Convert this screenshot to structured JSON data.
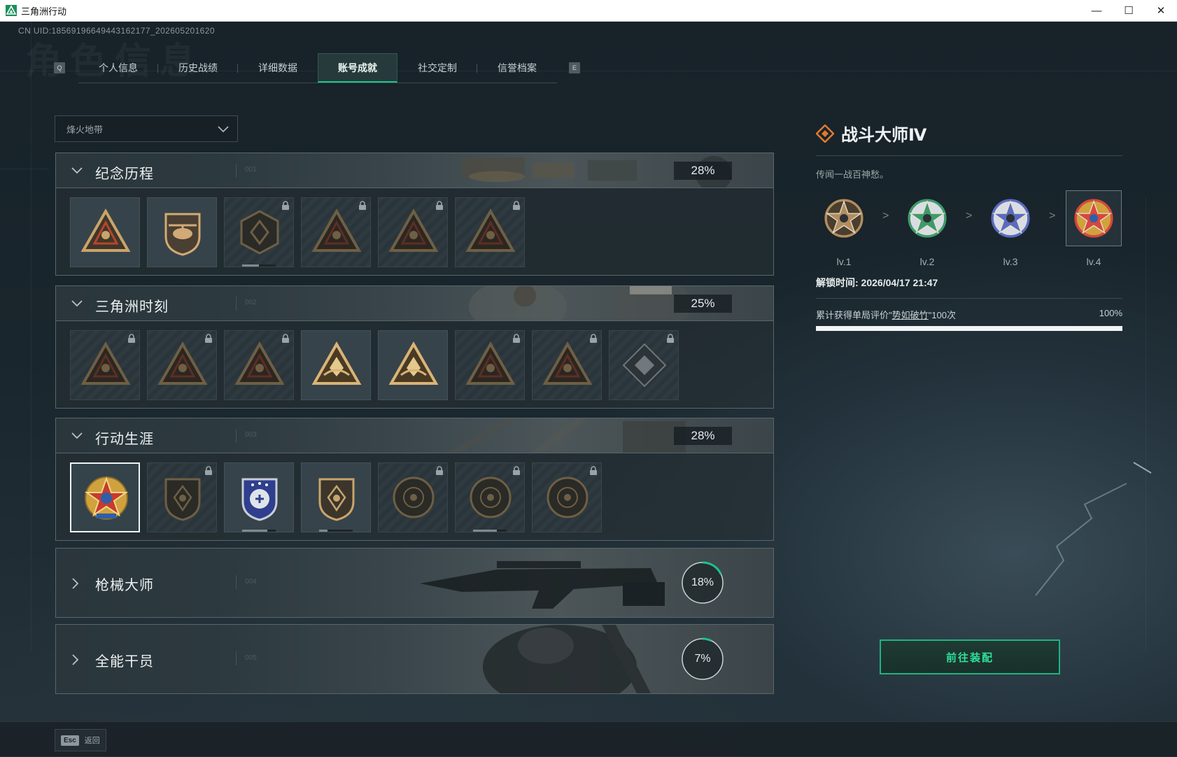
{
  "window": {
    "title": "三角洲行动",
    "controls": {
      "minimize": "—",
      "maximize": "☐",
      "close": "✕"
    }
  },
  "bg_word": "角色信息",
  "uid": "CN UID:18569196649443162177_202605201620",
  "tabs": {
    "key_left": "Q",
    "key_right": "E",
    "items": [
      {
        "label": "个人信息"
      },
      {
        "label": "历史战绩"
      },
      {
        "label": "详细数据"
      },
      {
        "label": "账号成就",
        "active": true
      },
      {
        "label": "社交定制"
      },
      {
        "label": "信誉档案"
      }
    ]
  },
  "filter": {
    "selected": "烽火地带"
  },
  "sections": [
    {
      "title": "纪念历程",
      "num": "001",
      "percent": "28%",
      "expanded": true
    },
    {
      "title": "三角洲时刻",
      "num": "002",
      "percent": "25%",
      "expanded": true
    },
    {
      "title": "行动生涯",
      "num": "003",
      "percent": "28%",
      "expanded": true
    },
    {
      "title": "枪械大师",
      "num": "004",
      "percent": "18%",
      "progress": 0.18,
      "expanded": false
    },
    {
      "title": "全能干员",
      "num": "005",
      "percent": "7%",
      "progress": 0.07,
      "expanded": false
    }
  ],
  "badges": {
    "s1": [
      {
        "icon": "triangle-shield-badge-icon",
        "locked": false
      },
      {
        "icon": "helicopter-badge-icon",
        "locked": false
      },
      {
        "icon": "hex-emblem-badge-icon",
        "locked": true,
        "progress": 0.5
      },
      {
        "icon": "warrior-triangle-badge-icon",
        "locked": true
      },
      {
        "icon": "hooded-figure-badge-icon",
        "locked": true
      },
      {
        "icon": "skull-triangle-badge-icon",
        "locked": true
      }
    ],
    "s2": [
      {
        "icon": "bottle-triangle-badge-icon",
        "locked": true
      },
      {
        "icon": "soldier-triangle-badge-icon",
        "locked": true
      },
      {
        "icon": "crouching-figure-badge-icon",
        "locked": true
      },
      {
        "icon": "hands-crystal-badge-icon",
        "locked": false
      },
      {
        "icon": "strongman-badge-icon",
        "locked": false
      },
      {
        "icon": "beast-triangle-badge-icon",
        "locked": true
      },
      {
        "icon": "fish-triangle-badge-icon",
        "locked": true
      },
      {
        "icon": "crystal-diamond-badge-icon",
        "locked": true
      }
    ],
    "s3": [
      {
        "icon": "combat-master-star-badge-icon",
        "locked": false,
        "selected": true
      },
      {
        "icon": "winged-shield-badge-icon",
        "locked": true
      },
      {
        "icon": "blue-star-shield-badge-icon",
        "locked": false,
        "progress": 0.75
      },
      {
        "icon": "gem-shield-badge-icon",
        "locked": false,
        "progress": 0.25
      },
      {
        "icon": "shell-circle-badge-icon",
        "locked": true
      },
      {
        "icon": "skull-circle-badge-icon",
        "locked": true,
        "progress": 0.7
      },
      {
        "icon": "eye-circle-badge-icon",
        "locked": true
      }
    ]
  },
  "detail": {
    "title": "战斗大师Ⅳ",
    "description": "传闻一战百神愁。",
    "levels": [
      {
        "label": "lv.1",
        "icon": "bronze-star-medal-icon",
        "color": "#b28d5e"
      },
      {
        "label": "lv.2",
        "icon": "green-star-medal-icon",
        "color": "#3f9a6a"
      },
      {
        "label": "lv.3",
        "icon": "blue-star-medal-icon",
        "color": "#5a6bc0"
      },
      {
        "label": "lv.4",
        "icon": "gold-star-medal-icon",
        "color": "#d6473d",
        "selected": true
      }
    ],
    "separator": ">",
    "unlock_time": "解锁时间: 2026/04/17 21:47",
    "condition": {
      "prefix": "累计获得单局评价\"",
      "highlight": "势如破竹",
      "suffix": "\"100次"
    },
    "condition_percent": "100%",
    "condition_progress": 1.0,
    "equip_button": "前往装配"
  },
  "footer": {
    "key": "Esc",
    "label": "返回"
  },
  "colors": {
    "accent": "#1fc28a",
    "panel_bg": "#26303a",
    "text": "#d6dde0"
  }
}
